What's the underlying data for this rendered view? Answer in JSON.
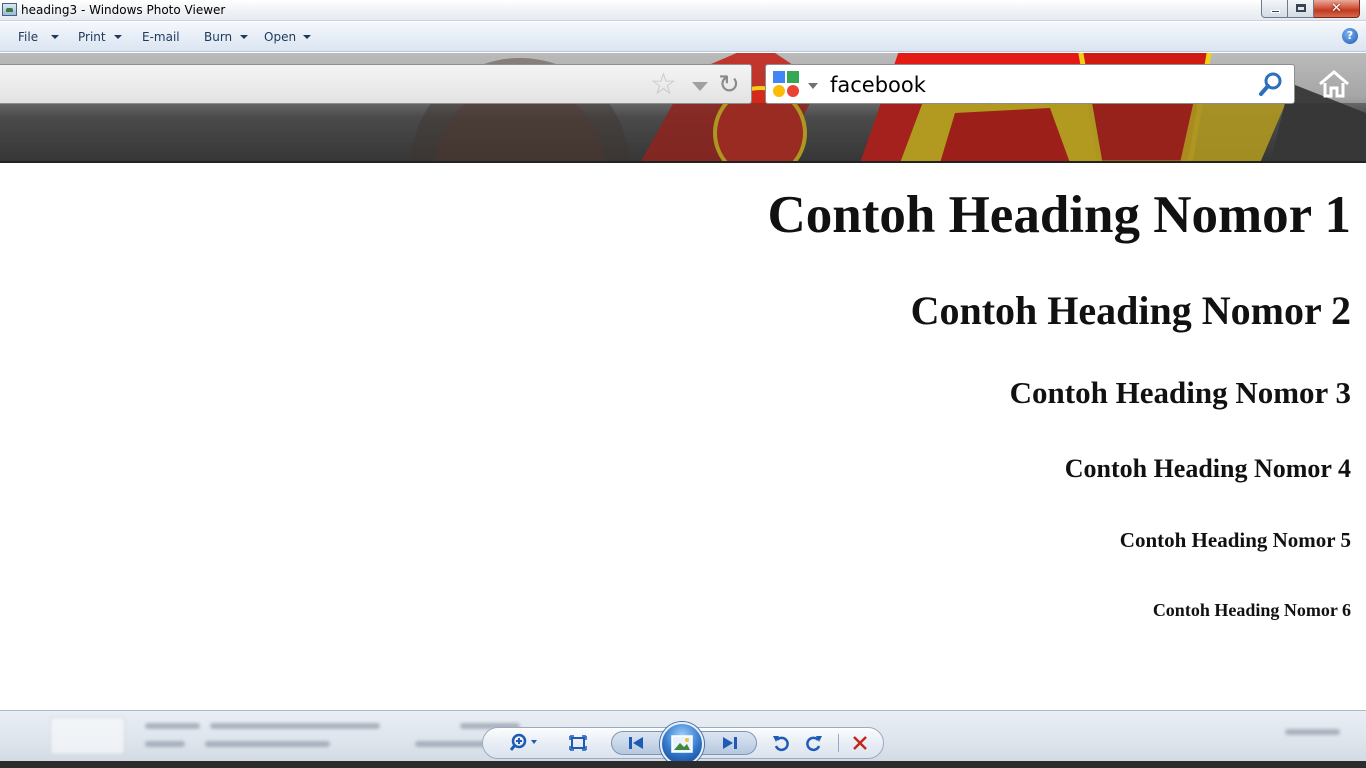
{
  "window": {
    "title": "heading3 - Windows Photo Viewer",
    "close_glyph": "✕",
    "icons": [
      "photo-viewer-icon",
      "minimize-icon",
      "maximize-icon",
      "close-icon"
    ]
  },
  "menu": {
    "items": [
      {
        "label": "File",
        "has_dropdown": true
      },
      {
        "label": "Print",
        "has_dropdown": true
      },
      {
        "label": "E-mail",
        "has_dropdown": false
      },
      {
        "label": "Burn",
        "has_dropdown": true
      },
      {
        "label": "Open",
        "has_dropdown": true
      }
    ],
    "help_glyph": "?"
  },
  "browser": {
    "star_glyph": "☆",
    "reload_glyph": "↻",
    "search": {
      "value": "facebook"
    },
    "icons": [
      "star-icon",
      "dropdown-icon",
      "reload-icon",
      "google-icon",
      "search-icon",
      "home-icon"
    ]
  },
  "page": {
    "headings": [
      "Contoh Heading Nomor 1",
      "Contoh Heading Nomor 2",
      "Contoh Heading Nomor 3",
      "Contoh Heading Nomor 4",
      "Contoh Heading Nomor 5",
      "Contoh Heading Nomor 6"
    ],
    "alignment": "right"
  },
  "controls": {
    "icons": [
      "zoom-icon",
      "actual-size-icon",
      "previous-icon",
      "slideshow-icon",
      "next-icon",
      "rotate-left-icon",
      "rotate-right-icon",
      "delete-icon"
    ]
  },
  "colors": {
    "menu_text": "#1e395b",
    "control_blue": "#1d5bb5",
    "delete_red": "#c0281c",
    "banner_red": "#e31b14",
    "banner_yellow": "#f7d417"
  }
}
